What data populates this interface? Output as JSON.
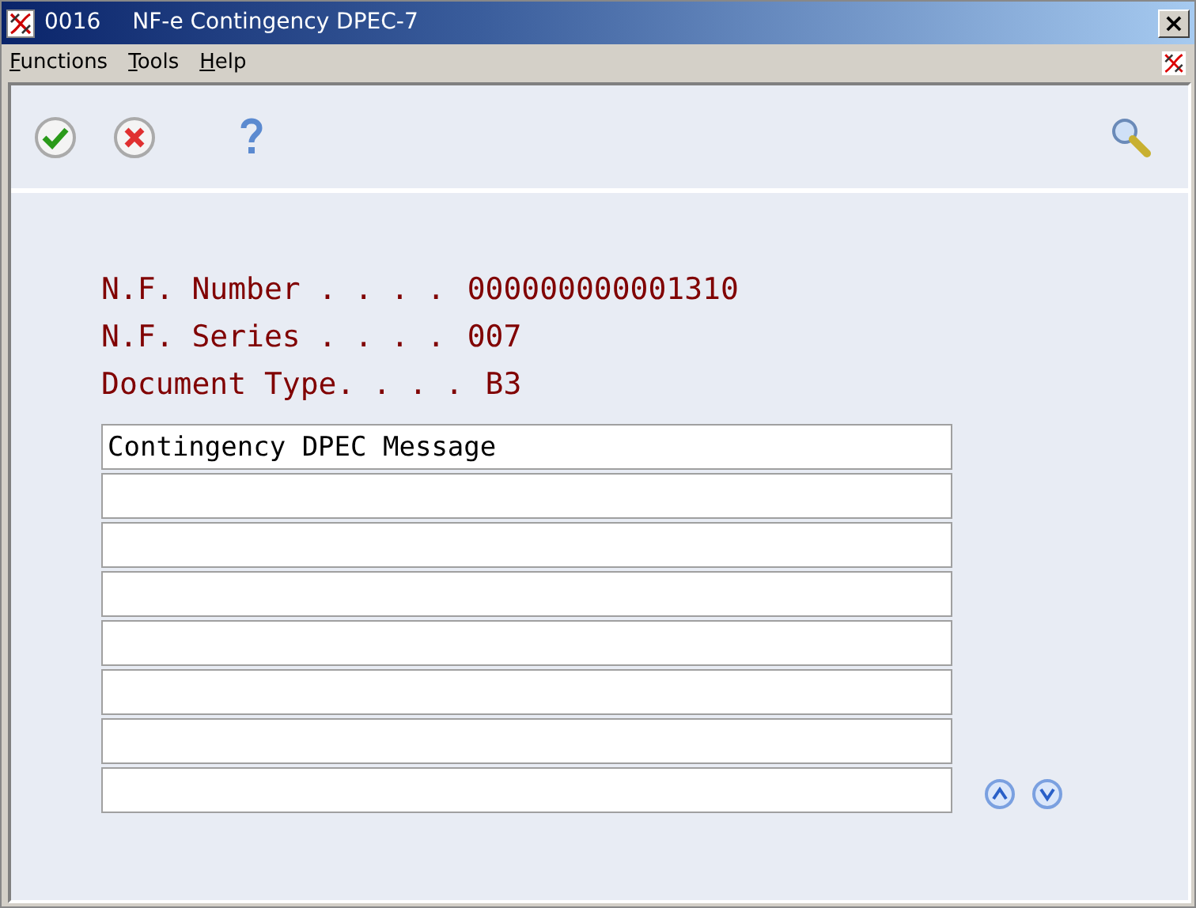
{
  "window": {
    "number": "0016",
    "title": "NF-e Contingency DPEC-7",
    "close": "×"
  },
  "menu": [
    {
      "label": "Functions"
    },
    {
      "label": "Tools"
    },
    {
      "label": "Help"
    }
  ],
  "toolbar": [
    {
      "kind": "ok"
    },
    {
      "kind": "cancel"
    },
    {
      "kind": "help"
    }
  ],
  "fields": [
    {
      "label": "N.F. Number . . . .",
      "value": "000000000001310"
    },
    {
      "label": "N.F. Series . . . .",
      "value": "007"
    },
    {
      "label": "Document Type. . . .",
      "value": "B3"
    }
  ],
  "message_lines": [
    {
      "kind": "filled",
      "value": "Contingency DPEC Message"
    },
    {
      "kind": "blank"
    },
    {
      "kind": "blank"
    },
    {
      "kind": "blank"
    },
    {
      "kind": "blank"
    },
    {
      "kind": "blank"
    },
    {
      "kind": "blank"
    },
    {
      "kind": "blank"
    }
  ]
}
